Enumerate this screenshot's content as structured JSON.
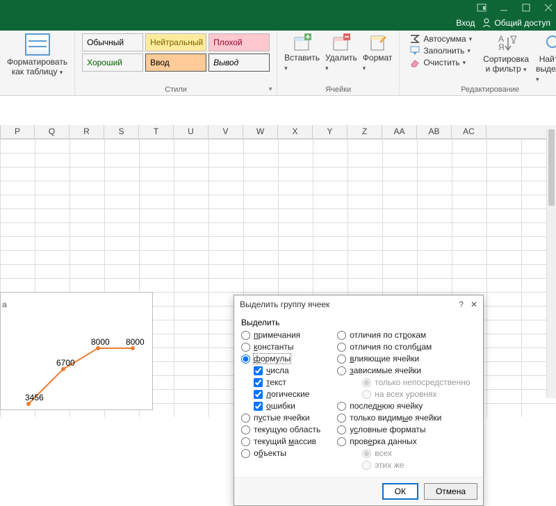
{
  "titlebar": {
    "login": "Вход",
    "share": "Общий доступ"
  },
  "ribbon": {
    "format_table": {
      "line1": "Форматировать",
      "line2": "как таблицу"
    },
    "styles_group_label": "Стили",
    "styles": {
      "normal": "Обычный",
      "neutral": "Нейтральный",
      "bad": "Плохой",
      "good": "Хороший",
      "input": "Ввод",
      "output": "Вывод"
    },
    "cells": {
      "insert": "Вставить",
      "delete": "Удалить",
      "format": "Формат",
      "group_label": "Ячейки"
    },
    "editing": {
      "autosum": "Автосумма",
      "fill": "Заполнить",
      "clear": "Очистить",
      "sort_filter1": "Сортировка",
      "sort_filter2": "и фильтр",
      "find1": "Найти и",
      "find2": "выделить",
      "group_label": "Редактирование"
    }
  },
  "columns": [
    "P",
    "Q",
    "R",
    "S",
    "T",
    "U",
    "V",
    "W",
    "X",
    "Y",
    "Z",
    "AA",
    "AB",
    "AC"
  ],
  "chart_data": {
    "type": "line",
    "x": [
      1,
      2,
      3,
      4
    ],
    "values": [
      3456,
      6700,
      8000,
      8000
    ],
    "labels": [
      "3456",
      "6700",
      "8000",
      "8000"
    ],
    "ylabel_fragment": "а"
  },
  "dialog": {
    "title": "Выделить группу ячеек",
    "section": "Выделить",
    "left": {
      "comments": "примечания",
      "constants": "константы",
      "formulas": "формулы",
      "numbers": "числа",
      "text": "текст",
      "logical": "логические",
      "errors": "ошибки",
      "blanks": "пустые ячейки",
      "current_region": "текущую область",
      "current_array": "текущий массив",
      "objects": "объекты"
    },
    "right": {
      "row_diffs": "отличия по строкам",
      "col_diffs": "отличия по столбцам",
      "precedents": "влияющие ячейки",
      "dependents": "зависимые ячейки",
      "direct_only": "только непосредственно",
      "all_levels": "на всех уровнях",
      "last_cell": "последнюю ячейку",
      "visible_only": "только видимые ячейки",
      "cond_formats": "условные форматы",
      "data_validation": "проверка данных",
      "all": "всех",
      "same": "этих же"
    },
    "buttons": {
      "ok": "ОК",
      "cancel": "Отмена"
    }
  }
}
